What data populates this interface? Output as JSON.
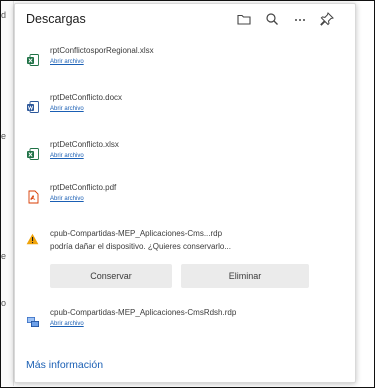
{
  "panel": {
    "title": "Descargas",
    "more_info": "Más información"
  },
  "header_icons": [
    "folder-icon",
    "search-icon",
    "more-icon",
    "pin-icon"
  ],
  "downloads": [
    {
      "name": "rptConflictosporRegional.xlsx",
      "link": "Abrir archivo",
      "type": "xlsx"
    },
    {
      "name": "rptDetConflicto.docx",
      "link": "Abrir archivo",
      "type": "docx"
    },
    {
      "name": "rptDetConflicto.xlsx",
      "link": "Abrir archivo",
      "type": "xlsx"
    },
    {
      "name": "rptDetConflicto.pdf",
      "link": "Abrir archivo",
      "type": "pdf"
    }
  ],
  "warning": {
    "line1": "cpub-Compartidas-MEP_Aplicaciones-Cms...rdp",
    "line2": "podría dañar el dispositivo. ¿Quieres conservarlo...",
    "keep": "Conservar",
    "delete": "Eliminar"
  },
  "last_item": {
    "name": "cpub-Compartidas-MEP_Aplicaciones-CmsRdsh.rdp",
    "link": "Abrir archivo",
    "type": "rdp"
  },
  "background": {
    "left_letters": [
      "d",
      "e",
      "e",
      "o"
    ]
  },
  "colors": {
    "accent": "#1a5fb4",
    "excel": "#1e7145",
    "word": "#2b579a",
    "pdf": "#d83b01",
    "warning": "#f0a30a"
  }
}
